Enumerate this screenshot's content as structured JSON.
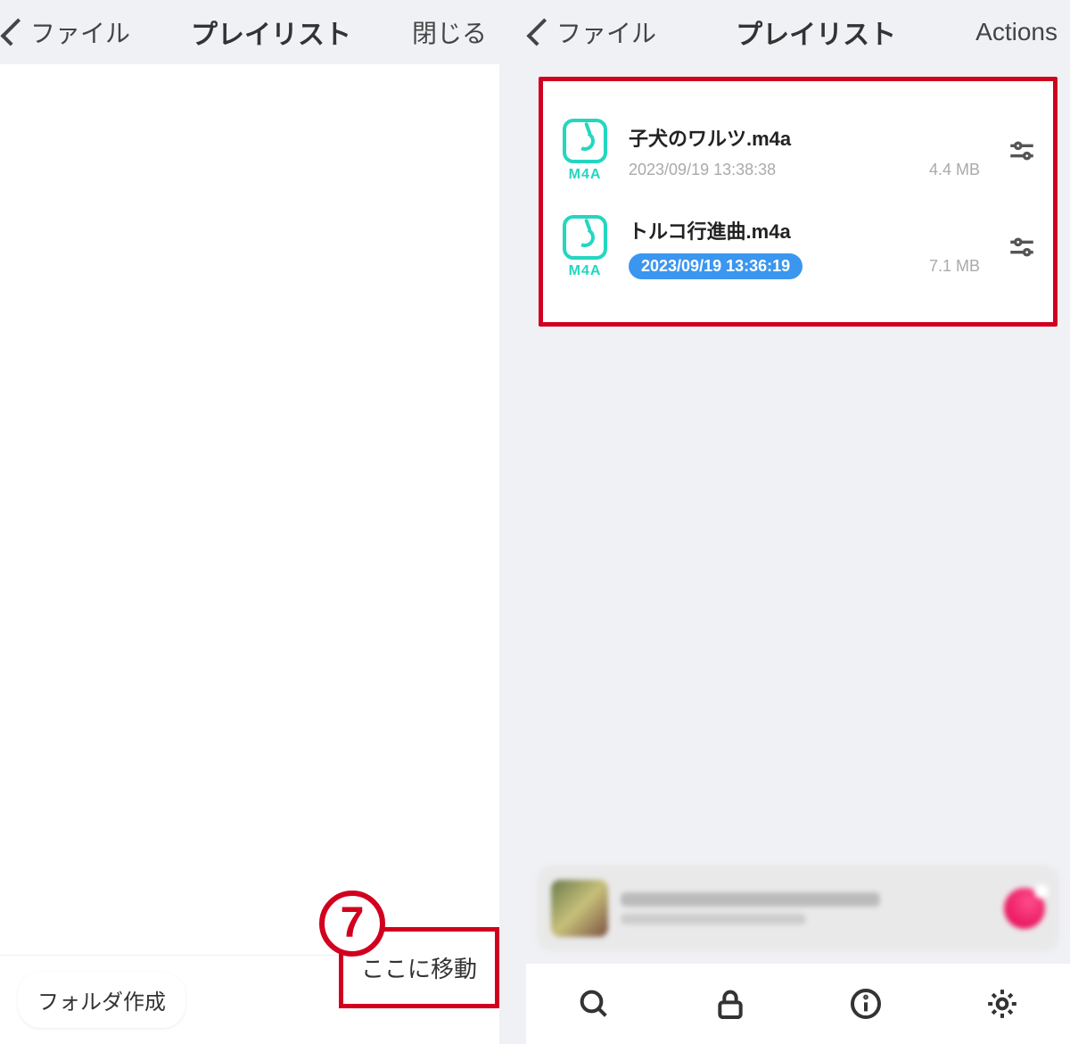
{
  "left": {
    "back_label": "ファイル",
    "title": "プレイリスト",
    "close": "閉じる",
    "create_folder": "フォルダ作成",
    "move_here": "ここに移動"
  },
  "right": {
    "back_label": "ファイル",
    "title": "プレイリスト",
    "actions": "Actions",
    "files": [
      {
        "type": "M4A",
        "name": "子犬のワルツ.m4a",
        "timestamp": "2023/09/19 13:38:38",
        "size": "4.4 MB",
        "highlighted": false
      },
      {
        "type": "M4A",
        "name": "トルコ行進曲.m4a",
        "timestamp": "2023/09/19 13:36:19",
        "size": "7.1 MB",
        "highlighted": true
      }
    ],
    "tabs": [
      "search",
      "lock",
      "info",
      "settings"
    ]
  },
  "annotation": {
    "step": "7"
  }
}
